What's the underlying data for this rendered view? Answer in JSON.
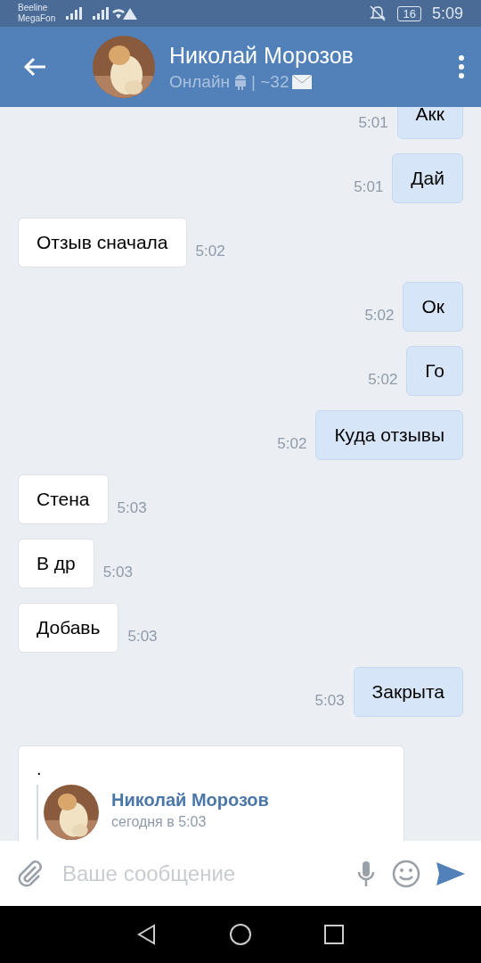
{
  "status_bar": {
    "carriers": [
      "Beeline",
      "MegaFon"
    ],
    "battery": "16",
    "time": "5:09"
  },
  "header": {
    "name": "Николай Морозов",
    "status": "Онлайн",
    "separator": "| ~32"
  },
  "messages": [
    {
      "text": "Акк",
      "time": "5:01",
      "outgoing": true
    },
    {
      "text": "Дай",
      "time": "5:01",
      "outgoing": true
    },
    {
      "text": "Отзыв сначала",
      "time": "5:02",
      "outgoing": false
    },
    {
      "text": "Ок",
      "time": "5:02",
      "outgoing": true
    },
    {
      "text": "Го",
      "time": "5:02",
      "outgoing": true
    },
    {
      "text": "Куда отзывы",
      "time": "5:02",
      "outgoing": true
    },
    {
      "text": "Стена",
      "time": "5:03",
      "outgoing": false
    },
    {
      "text": "В др",
      "time": "5:03",
      "outgoing": false
    },
    {
      "text": "Добавь",
      "time": "5:03",
      "outgoing": false
    },
    {
      "text": "Закрыта",
      "time": "5:03",
      "outgoing": true
    }
  ],
  "forwarded": {
    "text": ".",
    "author": "Николай Морозов",
    "date": "сегодня в 5:03"
  },
  "composer": {
    "placeholder": "Ваше сообщение"
  }
}
